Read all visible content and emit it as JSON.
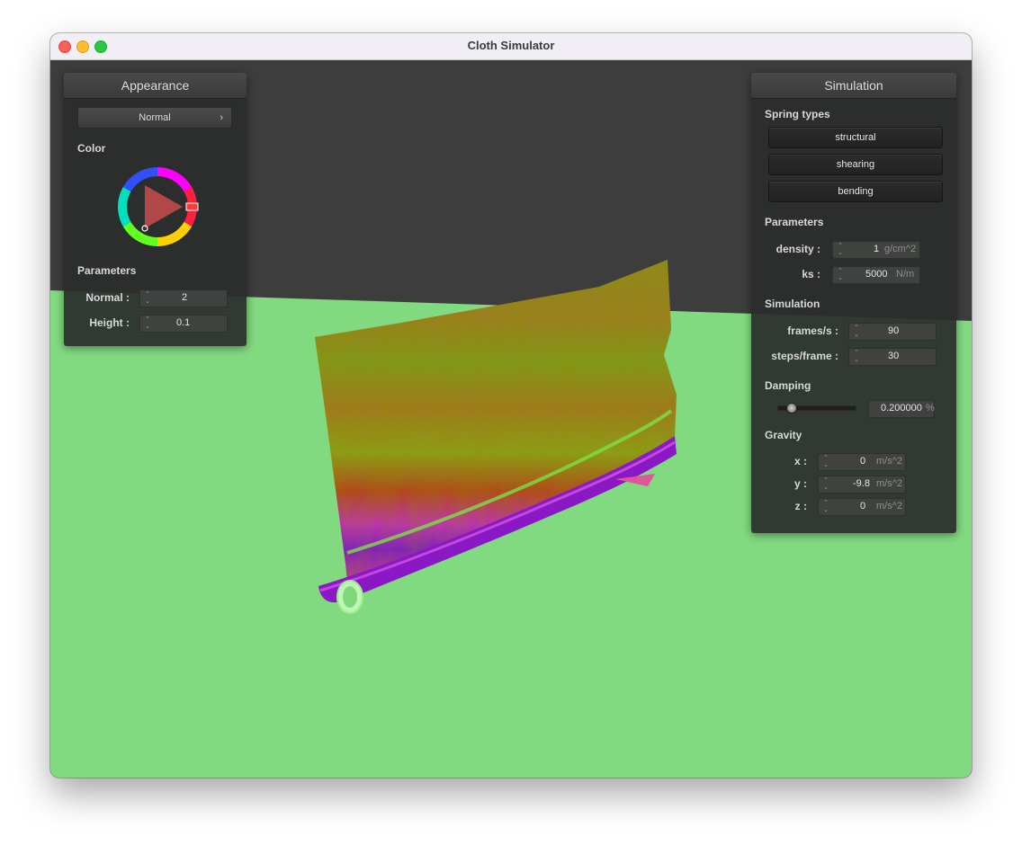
{
  "window": {
    "title": "Cloth Simulator"
  },
  "appearance": {
    "header": "Appearance",
    "shader_selected": "Normal",
    "color_label": "Color",
    "parameters_label": "Parameters",
    "normal": {
      "label": "Normal :",
      "value": "2"
    },
    "height": {
      "label": "Height :",
      "value": "0.1"
    }
  },
  "simulation": {
    "header": "Simulation",
    "spring_types_label": "Spring types",
    "spring_buttons": [
      "structural",
      "shearing",
      "bending"
    ],
    "parameters_label": "Parameters",
    "density": {
      "label": "density :",
      "value": "1",
      "unit": "g/cm^2"
    },
    "ks": {
      "label": "ks :",
      "value": "5000",
      "unit": "N/m"
    },
    "sim_label": "Simulation",
    "frames": {
      "label": "frames/s :",
      "value": "90"
    },
    "steps": {
      "label": "steps/frame :",
      "value": "30"
    },
    "damping_label": "Damping",
    "damping": {
      "value": "0.200000",
      "unit": "%",
      "fraction": 0.2
    },
    "gravity_label": "Gravity",
    "gx": {
      "label": "x :",
      "value": "0",
      "unit": "m/s^2"
    },
    "gy": {
      "label": "y :",
      "value": "-9.8",
      "unit": "m/s^2"
    },
    "gz": {
      "label": "z :",
      "value": "0",
      "unit": "m/s^2"
    }
  },
  "colors": {
    "floor": "#82da80",
    "background": "#3d3d3d",
    "panel": "#2c2e2d",
    "hue_marker": "#ff3b3b"
  },
  "icons": {
    "spinner": "spinner-arrows-icon",
    "chevron": "chevron-right-icon",
    "color_wheel": "color-wheel-icon"
  }
}
